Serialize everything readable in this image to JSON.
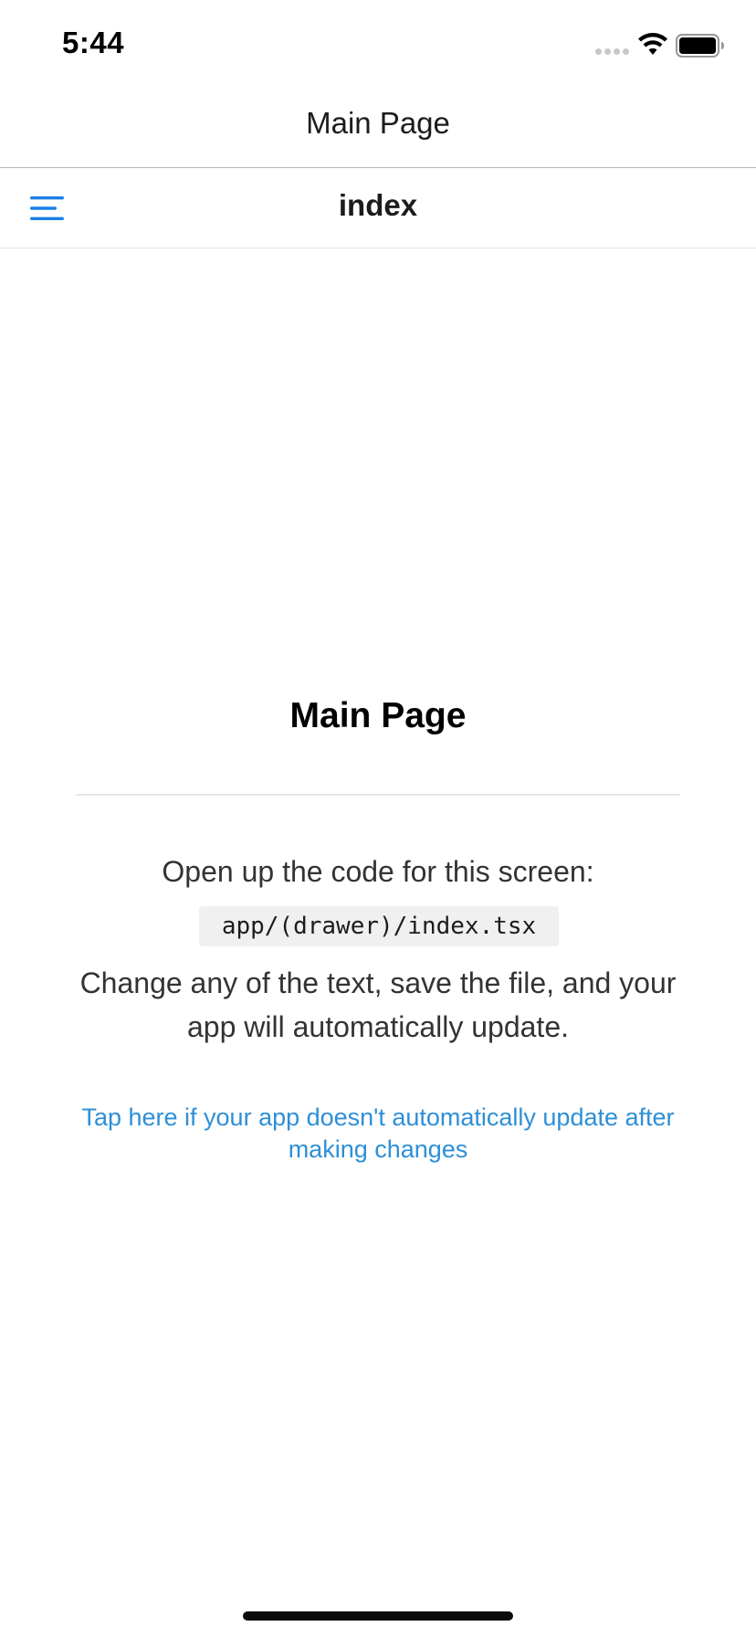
{
  "status_bar": {
    "time": "5:44",
    "icons": [
      "cellular-signal-icon",
      "wifi-icon",
      "battery-icon"
    ]
  },
  "nav_header": {
    "title": "Main Page"
  },
  "drawer_header": {
    "title": "index",
    "menu_icon": "menu-icon"
  },
  "main": {
    "heading": "Main Page",
    "intro": "Open up the code for this screen:",
    "code_path": "app/(drawer)/index.tsx",
    "change_text": "Change any of the text, save the file, and your app will automatically update.",
    "help_link": "Tap here if your app doesn't automatically update after making changes"
  },
  "colors": {
    "accent": "#1a80e6",
    "link": "#2e8fd6",
    "text": "#333333",
    "background": "#ffffff"
  }
}
